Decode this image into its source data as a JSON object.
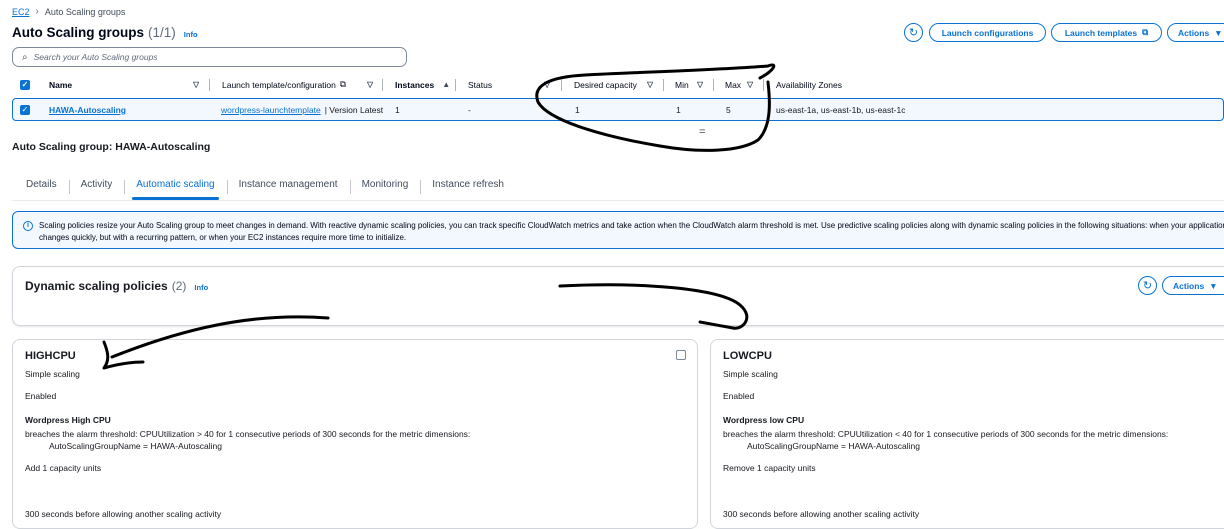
{
  "breadcrumb": {
    "root": "EC2",
    "current": "Auto Scaling groups"
  },
  "page": {
    "title": "Auto Scaling groups",
    "count": "(1/1)",
    "info": "Info"
  },
  "header_buttons": {
    "refresh_icon": "refresh-icon",
    "launch_configurations": "Launch configurations",
    "launch_templates": "Launch templates",
    "actions": "Actions"
  },
  "search": {
    "placeholder": "Search your Auto Scaling groups"
  },
  "table": {
    "columns": {
      "name": "Name",
      "launch_template": "Launch template/configuration",
      "instances": "Instances",
      "status": "Status",
      "desired_capacity": "Desired capacity",
      "min": "Min",
      "max": "Max",
      "availability_zones": "Availability Zones"
    },
    "rows": [
      {
        "name": "HAWA-Autoscaling",
        "launch_template": "wordpress-launchtemplate",
        "launch_version": "| Version Latest",
        "instances": "1",
        "status": "-",
        "desired_capacity": "1",
        "min": "1",
        "max": "5",
        "availability_zones": "us-east-1a, us-east-1b, us-east-1c"
      }
    ]
  },
  "resize_handle": "=",
  "details": {
    "title": "Auto Scaling group: HAWA-Autoscaling",
    "tabs": [
      "Details",
      "Activity",
      "Automatic scaling",
      "Instance management",
      "Monitoring",
      "Instance refresh"
    ],
    "active_tab": "Automatic scaling"
  },
  "banner": {
    "line1": "Scaling policies resize your Auto Scaling group to meet changes in demand. With reactive dynamic scaling policies, you can track specific CloudWatch metrics and take action when the CloudWatch alarm threshold is met. Use predictive scaling policies along with dynamic scaling policies in the following situations: when your application demand",
    "line2": "changes quickly, but with a recurring pattern, or when your EC2 instances require more time to initialize."
  },
  "dynamic_policies": {
    "title": "Dynamic scaling policies",
    "count": "(2)",
    "info": "Info",
    "actions": "Actions"
  },
  "policies": [
    {
      "name": "HIGHCPU",
      "type": "Simple scaling",
      "state": "Enabled",
      "alarm_name": "Wordpress High CPU",
      "alarm_desc": "breaches the alarm threshold: CPUUtilization > 40 for 1 consecutive periods of 300 seconds for the metric dimensions:",
      "dimension": "AutoScalingGroupName = HAWA-Autoscaling",
      "action": "Add 1 capacity units",
      "cooldown": "300 seconds before allowing another scaling activity"
    },
    {
      "name": "LOWCPU",
      "type": "Simple scaling",
      "state": "Enabled",
      "alarm_name": "Wordpress low CPU",
      "alarm_desc": "breaches the alarm threshold: CPUUtilization < 40 for 1 consecutive periods of 300 seconds for the metric dimensions:",
      "dimension": "AutoScalingGroupName = HAWA-Autoscaling",
      "action": "Remove 1 capacity units",
      "cooldown": "300 seconds before allowing another scaling activity"
    }
  ],
  "colors": {
    "accent": "#0972d3",
    "text": "#16191f",
    "selected_row": "#f2f8fd",
    "annotation": "#000000"
  }
}
